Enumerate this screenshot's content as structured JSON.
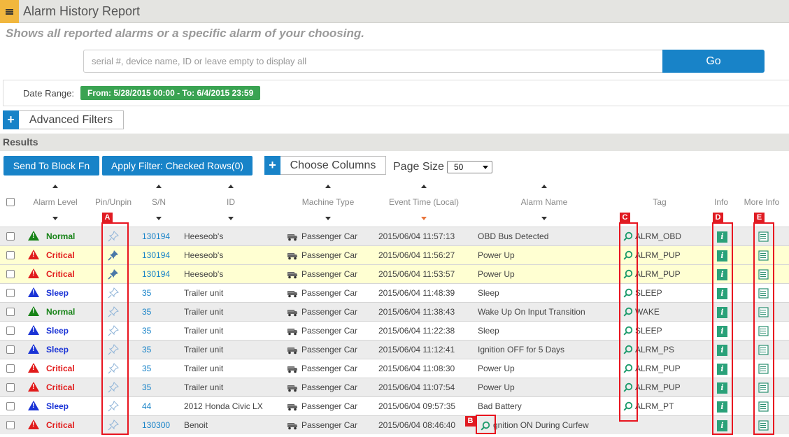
{
  "header": {
    "title": "Alarm History Report"
  },
  "subtitle": "Shows all reported alarms or a specific alarm of your choosing.",
  "search": {
    "placeholder": "serial #, device name, ID or leave empty to display all",
    "go_label": "Go"
  },
  "date_range": {
    "label": "Date Range:",
    "value": "From: 5/28/2015 00:00 - To: 6/4/2015 23:59"
  },
  "advanced_filters": {
    "plus": "+",
    "label": "Advanced Filters"
  },
  "results": {
    "title": "Results"
  },
  "toolbar": {
    "send_block": "Send To Block Fn",
    "apply_filter": "Apply Filter: Checked Rows(0)",
    "choose_columns_plus": "+",
    "choose_columns": "Choose Columns",
    "page_size_label": "Page Size",
    "page_size_value": "50"
  },
  "columns": {
    "alarm_level": "Alarm Level",
    "pin": "Pin/Unpin",
    "sn": "S/N",
    "id": "ID",
    "machine_type": "Machine Type",
    "event_time": "Event Time (Local)",
    "alarm_name": "Alarm Name",
    "tag": "Tag",
    "info": "Info",
    "more_info": "More Info"
  },
  "colors": {
    "normal": "#178317",
    "critical": "#e11b1b",
    "sleep": "#1a33d6",
    "accent": "#1883c8",
    "highlight_row": "#ffffd2"
  },
  "rows": [
    {
      "level": "Normal",
      "pinned": false,
      "sn": "130194",
      "id": "Heeseob's",
      "machine": "Passenger Car",
      "time": "2015/06/04 11:57:13",
      "alarm": "OBD Bus Detected",
      "tag": "ALRM_OBD",
      "info": "i"
    },
    {
      "level": "Critical",
      "pinned": true,
      "sn": "130194",
      "id": "Heeseob's",
      "machine": "Passenger Car",
      "time": "2015/06/04 11:56:27",
      "alarm": "Power Up",
      "tag": "ALRM_PUP",
      "info": "i"
    },
    {
      "level": "Critical",
      "pinned": true,
      "sn": "130194",
      "id": "Heeseob's",
      "machine": "Passenger Car",
      "time": "2015/06/04 11:53:57",
      "alarm": "Power Up",
      "tag": "ALRM_PUP",
      "info": "i"
    },
    {
      "level": "Sleep",
      "pinned": false,
      "sn": "35",
      "id": "Trailer unit",
      "machine": "Passenger Car",
      "time": "2015/06/04 11:48:39",
      "alarm": "Sleep",
      "tag": "SLEEP",
      "info": "i"
    },
    {
      "level": "Normal",
      "pinned": false,
      "sn": "35",
      "id": "Trailer unit",
      "machine": "Passenger Car",
      "time": "2015/06/04 11:38:43",
      "alarm": "Wake Up On Input Transition",
      "tag": "WAKE",
      "info": "i"
    },
    {
      "level": "Sleep",
      "pinned": false,
      "sn": "35",
      "id": "Trailer unit",
      "machine": "Passenger Car",
      "time": "2015/06/04 11:22:38",
      "alarm": "Sleep",
      "tag": "SLEEP",
      "info": "i"
    },
    {
      "level": "Sleep",
      "pinned": false,
      "sn": "35",
      "id": "Trailer unit",
      "machine": "Passenger Car",
      "time": "2015/06/04 11:12:41",
      "alarm": "Ignition OFF for 5 Days",
      "tag": "ALRM_PS",
      "info": "i"
    },
    {
      "level": "Critical",
      "pinned": false,
      "sn": "35",
      "id": "Trailer unit",
      "machine": "Passenger Car",
      "time": "2015/06/04 11:08:30",
      "alarm": "Power Up",
      "tag": "ALRM_PUP",
      "info": "i"
    },
    {
      "level": "Critical",
      "pinned": false,
      "sn": "35",
      "id": "Trailer unit",
      "machine": "Passenger Car",
      "time": "2015/06/04 11:07:54",
      "alarm": "Power Up",
      "tag": "ALRM_PUP",
      "info": "i"
    },
    {
      "level": "Sleep",
      "pinned": false,
      "sn": "44",
      "id": "2012 Honda Civic LX",
      "machine": "Passenger Car",
      "time": "2015/06/04 09:57:35",
      "alarm": "Bad Battery",
      "tag": "ALRM_PT",
      "info": "i"
    },
    {
      "level": "Critical",
      "pinned": false,
      "sn": "130300",
      "id": "Benoit",
      "machine": "Passenger Car",
      "time": "2015/06/04 08:46:40",
      "alarm": "Ignition ON During Curfew",
      "tag": "",
      "info": "i"
    }
  ],
  "annotations": [
    "A",
    "B",
    "C",
    "D",
    "E"
  ]
}
